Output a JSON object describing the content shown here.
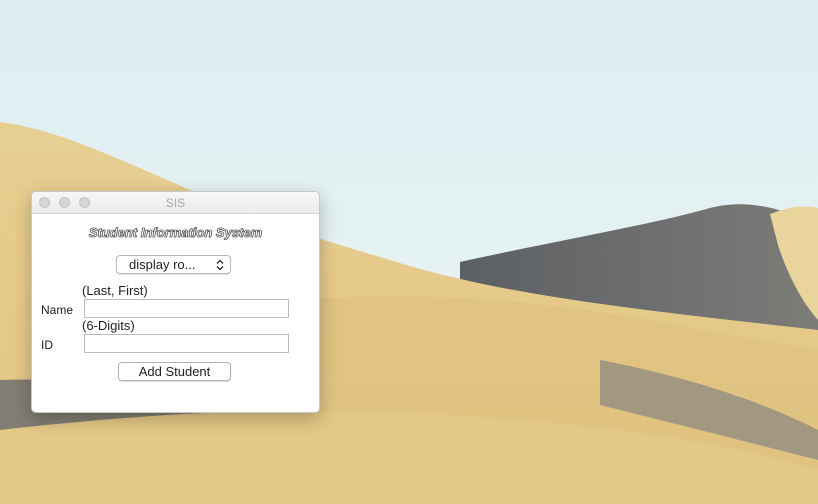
{
  "window": {
    "title": "SIS"
  },
  "heading": "Student Information System",
  "display_select": {
    "value": "display ro..."
  },
  "name_field": {
    "hint": "(Last, First)",
    "label": "Name",
    "value": ""
  },
  "id_field": {
    "hint": "(6-Digits)",
    "label": "ID",
    "value": ""
  },
  "add_button": {
    "label": "Add Student"
  }
}
